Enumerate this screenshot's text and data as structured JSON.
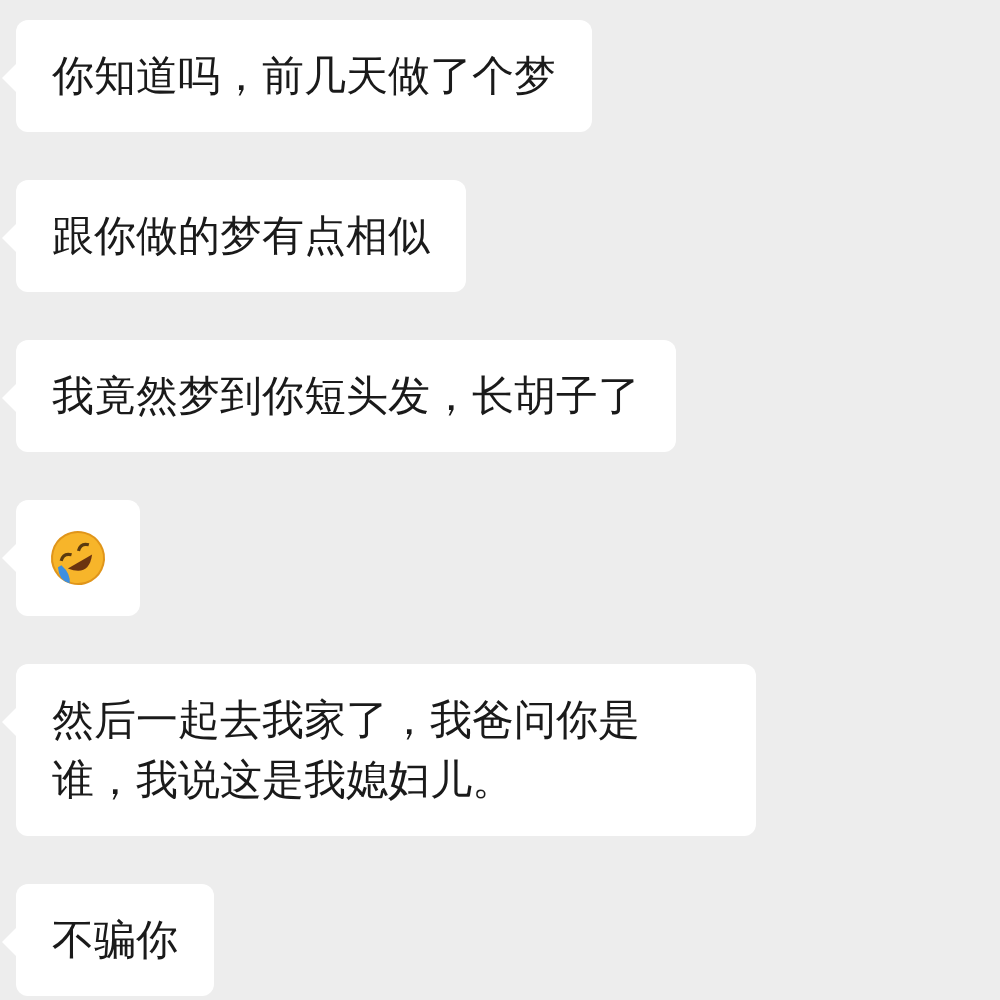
{
  "messages": [
    {
      "kind": "text",
      "text": "你知道吗，前几天做了个梦"
    },
    {
      "kind": "text",
      "text": "跟你做的梦有点相似"
    },
    {
      "kind": "text",
      "text": "我竟然梦到你短头发，长胡子了"
    },
    {
      "kind": "emoji"
    },
    {
      "kind": "text",
      "text": "然后一起去我家了，我爸问你是谁，我说这是我媳妇儿。"
    },
    {
      "kind": "text",
      "text": "不骗你"
    }
  ]
}
